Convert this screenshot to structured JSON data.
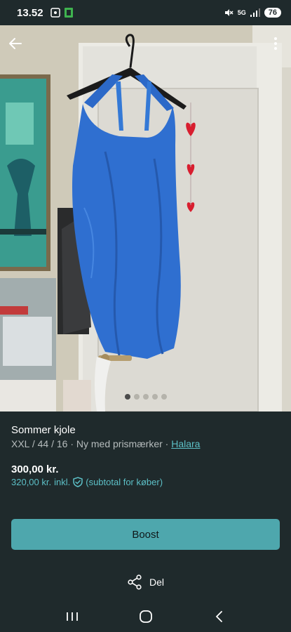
{
  "status_bar": {
    "time": "13.52",
    "network": "5G",
    "battery": "76",
    "icons": [
      "screenshot-icon",
      "app-notification-icon",
      "mute-icon",
      "signal-icon",
      "battery-icon"
    ]
  },
  "gallery": {
    "photo_count": 5,
    "active_index": 0,
    "icons": [
      "back-arrow-icon",
      "more-vertical-icon"
    ]
  },
  "listing": {
    "title": "Sommer kjole",
    "meta_prefix": "XXL / 44 / 16 · Ny med prismærker · ",
    "brand": "Halara",
    "price": "300,00 kr.",
    "price_incl": "320,00 kr.",
    "incl_label": "inkl.",
    "subtotal_note": "(subtotal for køber)"
  },
  "actions": {
    "boost_label": "Boost",
    "share_label": "Del"
  },
  "nav": {
    "icons": [
      "recent-apps-icon",
      "home-icon",
      "back-icon"
    ]
  },
  "colors": {
    "background": "#1f2a2c",
    "accent": "#5cbfc6",
    "button": "#4ea7ad",
    "dress": "#2f6fd0"
  }
}
